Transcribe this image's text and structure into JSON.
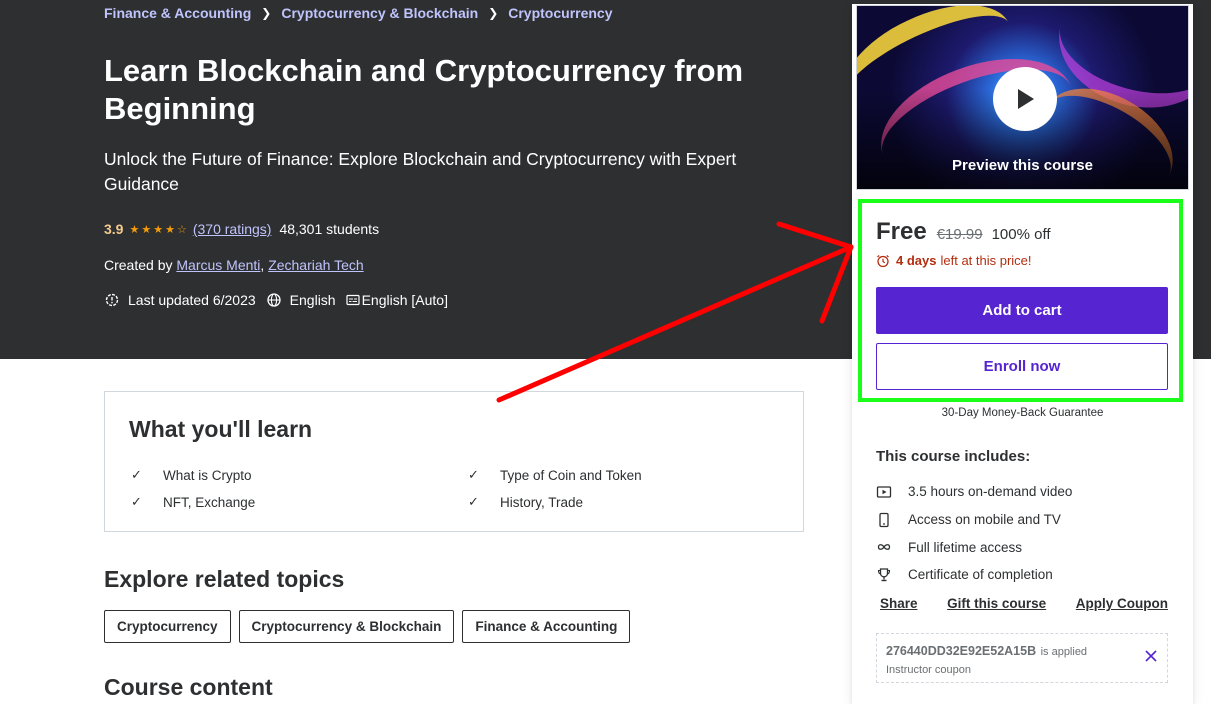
{
  "breadcrumb": [
    "Finance & Accounting",
    "Cryptocurrency & Blockchain",
    "Cryptocurrency"
  ],
  "course": {
    "title": "Learn Blockchain and Cryptocurrency from Beginning",
    "subtitle": "Unlock the Future of Finance: Explore Blockchain and Cryptocurrency with Expert Guidance",
    "rating": "3.9",
    "rating_value": 3.9,
    "ratings_count": "(370 ratings)",
    "students": "48,301 students",
    "created_by_label": "Created by",
    "instructors": [
      "Marcus Menti",
      "Zechariah Tech"
    ],
    "last_updated": "Last updated 6/2023",
    "language": "English",
    "captions": "English [Auto]"
  },
  "sidebar": {
    "preview_label": "Preview this course",
    "price": "Free",
    "original_price": "€19.99",
    "discount": "100% off",
    "timer_bold": "4 days",
    "timer_rest": "left at this price!",
    "add_to_cart": "Add to cart",
    "enroll_now": "Enroll now",
    "guarantee": "30-Day Money-Back Guarantee",
    "includes_title": "This course includes:",
    "includes": [
      {
        "icon": "video-icon",
        "label": "3.5 hours on-demand video"
      },
      {
        "icon": "mobile-icon",
        "label": "Access on mobile and TV"
      },
      {
        "icon": "infinity-icon",
        "label": "Full lifetime access"
      },
      {
        "icon": "trophy-icon",
        "label": "Certificate of completion"
      }
    ],
    "links": [
      "Share",
      "Gift this course",
      "Apply Coupon"
    ],
    "coupon_code": "276440DD32E92E52A15B",
    "coupon_applied": "is applied",
    "coupon_type": "Instructor coupon"
  },
  "learn": {
    "title": "What you'll learn",
    "items": [
      "What is Crypto",
      "Type of Coin and Token",
      "NFT, Exchange",
      "History, Trade"
    ]
  },
  "related": {
    "title": "Explore related topics",
    "topics": [
      "Cryptocurrency",
      "Cryptocurrency & Blockchain",
      "Finance & Accounting"
    ]
  },
  "course_content_title": "Course content",
  "colors": {
    "hero_bg": "#2d2f31",
    "brand_purple": "#5624d0",
    "link_lavender": "#c0c4fc",
    "star_orange": "#f69c08",
    "timer_red": "#b32d0f",
    "highlight_green": "#19ff19",
    "arrow_red": "#ff0000"
  }
}
